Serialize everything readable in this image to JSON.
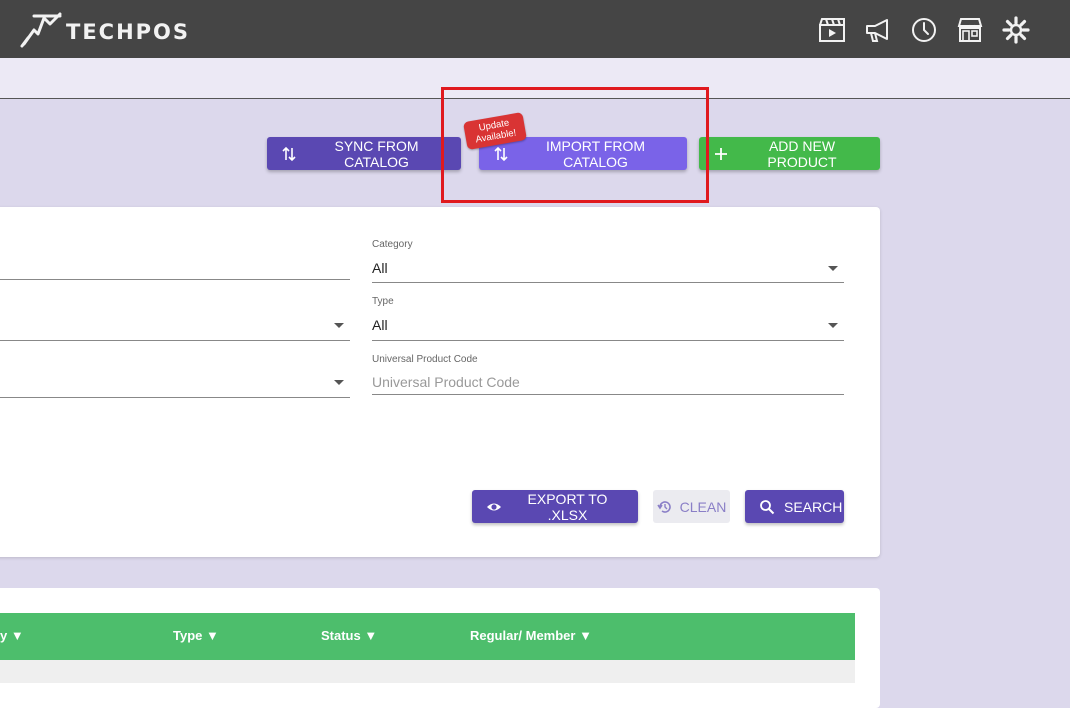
{
  "header": {
    "logo_text": "TECHPOS",
    "icons": [
      "clapperboard-icon",
      "megaphone-icon",
      "clock-icon",
      "store-icon",
      "gear-icon"
    ]
  },
  "actions": {
    "sync_label": "SYNC FROM CATALOG",
    "import_label": "IMPORT FROM CATALOG",
    "update_badge_line1": "Update",
    "update_badge_line2": "Available!",
    "add_label": "ADD NEW PRODUCT"
  },
  "filters": {
    "category": {
      "label": "Category",
      "value": "All"
    },
    "type": {
      "label": "Type",
      "value": "All"
    },
    "upc": {
      "label": "Universal Product Code",
      "placeholder": "Universal Product Code"
    }
  },
  "filter_actions": {
    "export_label": "EXPORT TO .XLSX",
    "clean_label": "CLEAN",
    "search_label": "SEARCH"
  },
  "table": {
    "columns": [
      "y ▼",
      "Type ▼",
      "Status ▼",
      "Regular/ Member ▼"
    ]
  },
  "colors": {
    "topbar": "#454545",
    "primary": "#5a48b2",
    "import": "#7a63e8",
    "success": "#43b94a",
    "table_header": "#4dbe6c",
    "highlight": "#e0191e",
    "badge": "#d93434"
  }
}
